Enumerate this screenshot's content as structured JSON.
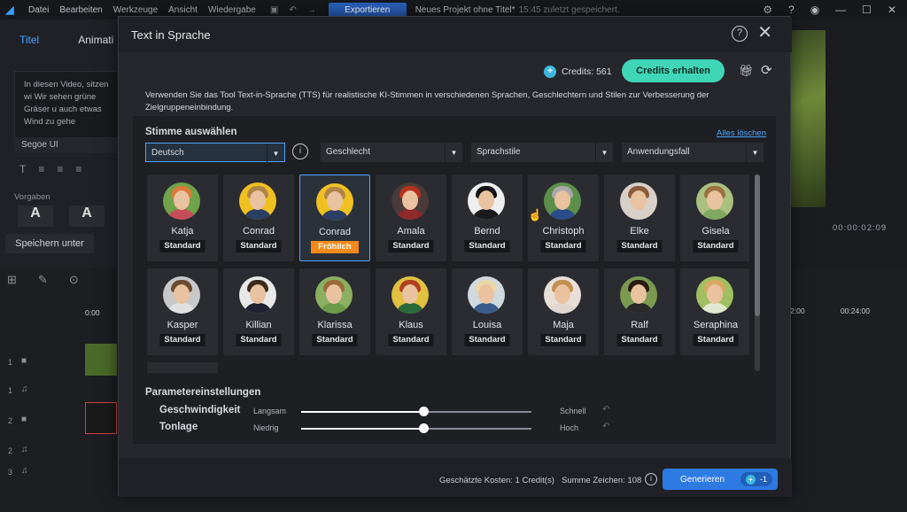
{
  "topbar": {
    "menu": [
      "Datei",
      "Bearbeiten",
      "Werkzeuge",
      "Ansicht",
      "Wiedergabe"
    ],
    "export_label": "Exportieren",
    "project_title": "Neues Projekt ohne Titel*",
    "saved_text": "15:45 zuletzt gespeichert."
  },
  "leftpanel": {
    "tabs": [
      "Titel",
      "Animati"
    ],
    "text_content": "In diesen Video, sitzen wi Wir sehen grüne Gräser u auch etwas Wind zu gehe",
    "font": "Segoe UI",
    "presets_label": "Vorgaben",
    "save_label": "Speichern unter"
  },
  "preview": {
    "timecode": "00:00:02:09",
    "timeline_marks": [
      "2:00",
      "00:24:00"
    ],
    "time_start": "0:00"
  },
  "dialog": {
    "title": "Text in Sprache",
    "credits_label": "Credits: 561",
    "credits_button": "Credits erhalten",
    "description": "Verwenden Sie das Tool Text-in-Sprache (TTS) für realistische KI-Stimmen in verschiedenen Sprachen, Geschlechtern und Stilen zur Verbesserung der Zielgruppeneinbindung.",
    "voice_section": "Stimme auswählen",
    "clear_all": "Alles löschen",
    "filters": {
      "language": "Deutsch",
      "gender": "Geschlecht",
      "style": "Sprachstile",
      "usecase": "Anwendungsfall"
    },
    "voices": [
      {
        "name": "Katja",
        "style": "Standard",
        "hair": "#d77a3a",
        "shirt": "#c84d5a",
        "bg": "#6fa24a"
      },
      {
        "name": "Conrad",
        "style": "Standard",
        "hair": "#b08448",
        "shirt": "#2b3e63",
        "bg": "#f0c020"
      },
      {
        "name": "Conrad",
        "style": "Fröhlich",
        "hair": "#b08448",
        "shirt": "#2b3e63",
        "bg": "#f0c020",
        "selected": true
      },
      {
        "name": "Amala",
        "style": "Standard",
        "hair": "#b8331f",
        "shirt": "#8f2a2a",
        "bg": "#4a3a3a"
      },
      {
        "name": "Bernd",
        "style": "Standard",
        "hair": "#111111",
        "shirt": "#1a1a1a",
        "bg": "#eeeeee"
      },
      {
        "name": "Christoph",
        "style": "Standard",
        "hair": "#a8a8a8",
        "shirt": "#2a4c8a",
        "bg": "#5c8f4a"
      },
      {
        "name": "Elke",
        "style": "Standard",
        "hair": "#8a5a3a",
        "shirt": "#d8d0c8",
        "bg": "#d8d0c8"
      },
      {
        "name": "Gisela",
        "style": "Standard",
        "hair": "#9a7040",
        "shirt": "#7fa860",
        "bg": "#aac080"
      },
      {
        "name": "Kasper",
        "style": "Standard",
        "hair": "#6a4a30",
        "shirt": "#e0e0e0",
        "bg": "#c8c8c8"
      },
      {
        "name": "Killian",
        "style": "Standard",
        "hair": "#3a2a1a",
        "shirt": "#1f2233",
        "bg": "#e8e8e8"
      },
      {
        "name": "Klarissa",
        "style": "Standard",
        "hair": "#9a6a3a",
        "shirt": "#6a9a4a",
        "bg": "#8ab060"
      },
      {
        "name": "Klaus",
        "style": "Standard",
        "hair": "#b04020",
        "shirt": "#2a6a3a",
        "bg": "#e0c040"
      },
      {
        "name": "Louisa",
        "style": "Standard",
        "hair": "#e8d8a8",
        "shirt": "#3a5a8a",
        "bg": "#d0d8e0"
      },
      {
        "name": "Maja",
        "style": "Standard",
        "hair": "#c09050",
        "shirt": "#e0d8d0",
        "bg": "#e8e0d8"
      },
      {
        "name": "Ralf",
        "style": "Standard",
        "hair": "#2a1a10",
        "shirt": "#2a2a2a",
        "bg": "#7a9a50"
      },
      {
        "name": "Seraphina",
        "style": "Standard",
        "hair": "#d8a860",
        "shirt": "#e0e8d0",
        "bg": "#a0c060"
      }
    ],
    "params_title": "Parametereinstellungen",
    "params": [
      {
        "label": "Geschwindigkeit",
        "low": "Langsam",
        "high": "Schnell",
        "value": 0.53
      },
      {
        "label": "Tonlage",
        "low": "Niedrig",
        "high": "Hoch",
        "value": 0.53
      }
    ],
    "footer": {
      "cost": "Geschätzte Kosten: 1 Credit(s)",
      "chars": "Summe Zeichen: 108",
      "generate": "Generieren",
      "generate_cost": "-1"
    }
  }
}
